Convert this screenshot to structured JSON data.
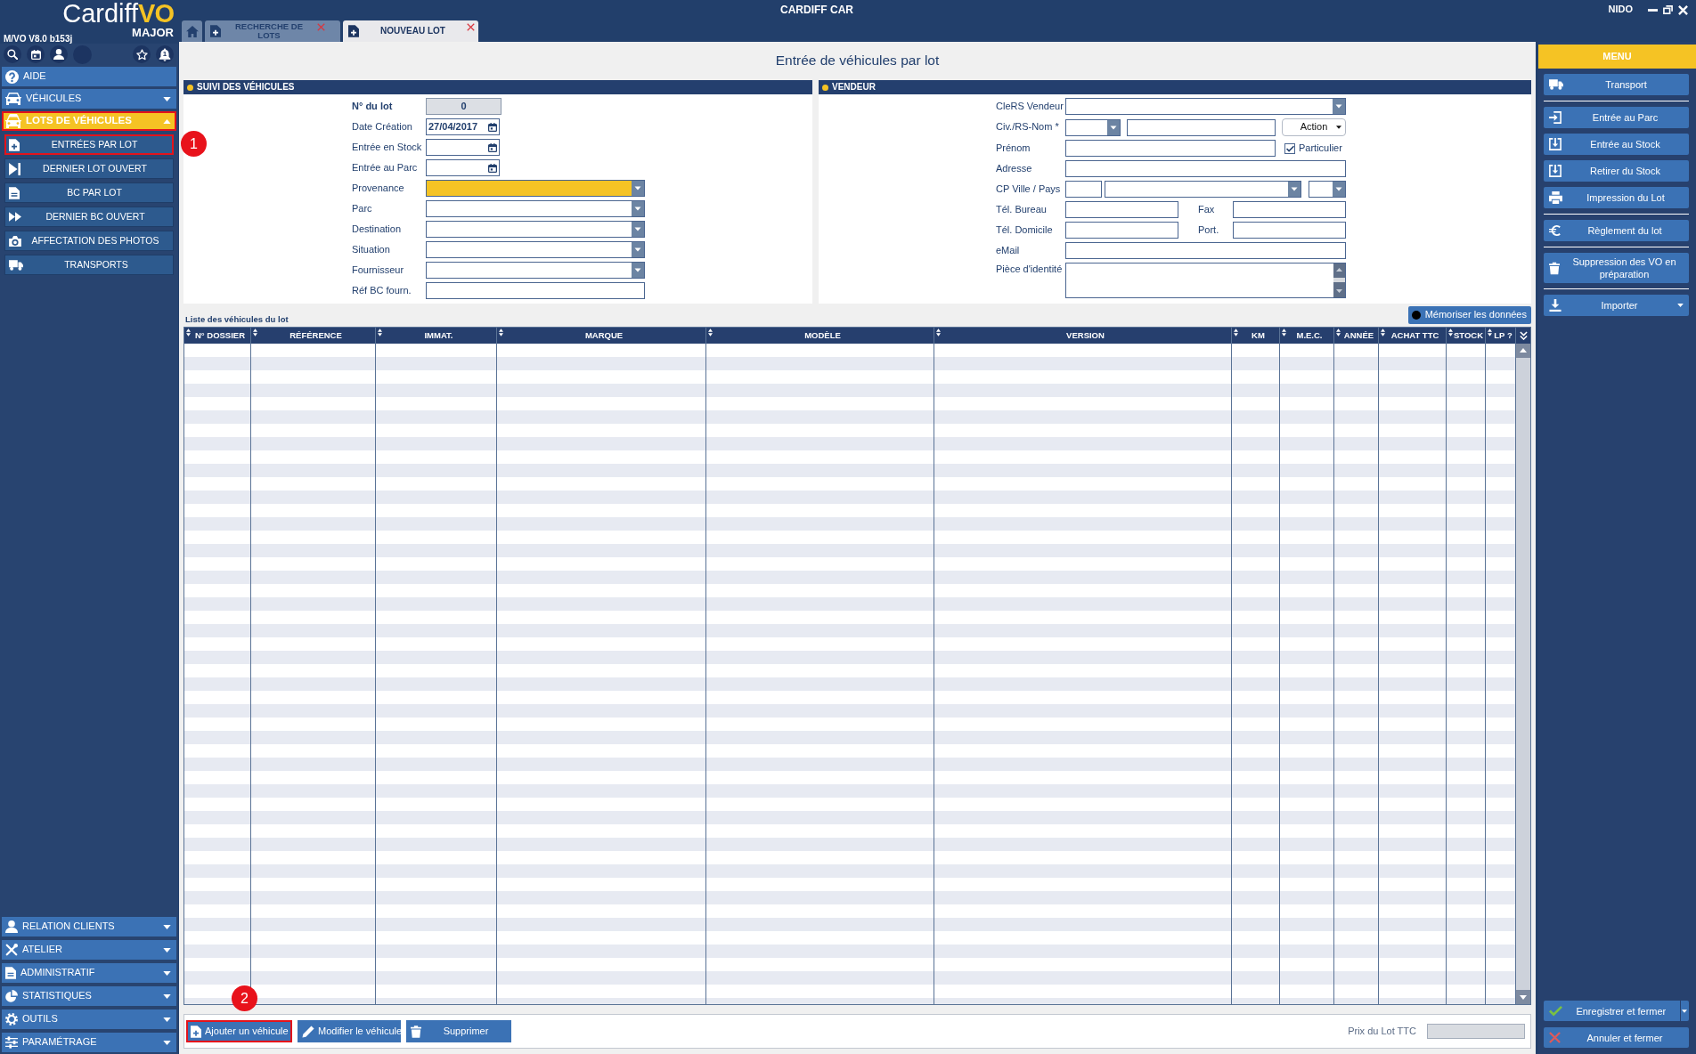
{
  "window": {
    "title": "CARDIFF CAR",
    "user": "NIDO"
  },
  "sidebar": {
    "logo": {
      "name": "Cardiff",
      "mark": "VO",
      "edition": "MAJOR"
    },
    "version": "M/VO V8.0 b153j",
    "notification_count": "1",
    "help": {
      "label": "AIDE"
    },
    "top_sections": [
      {
        "label": "VÉHICULES",
        "expanded": false,
        "selected": false,
        "highlighted": false
      },
      {
        "label": "LOTS DE VÉHICULES",
        "expanded": true,
        "selected": true,
        "highlighted": true,
        "children": [
          {
            "label": "ENTRÉES PAR LOT",
            "selected": false,
            "highlighted": true,
            "annotation": "1"
          },
          {
            "label": "DERNIER LOT OUVERT",
            "selected": false,
            "highlighted": false
          },
          {
            "label": "BC PAR LOT",
            "selected": false,
            "highlighted": false
          },
          {
            "label": "DERNIER BC OUVERT",
            "selected": false,
            "highlighted": false
          },
          {
            "label": "AFFECTATION DES PHOTOS",
            "selected": false,
            "highlighted": false
          },
          {
            "label": "TRANSPORTS",
            "selected": false,
            "highlighted": false
          }
        ]
      }
    ],
    "bottom_sections": [
      {
        "label": "RELATION CLIENTS",
        "expanded": false,
        "selected": false,
        "highlighted": false
      },
      {
        "label": "ATELIER",
        "expanded": false,
        "selected": false,
        "highlighted": false
      },
      {
        "label": "ADMINISTRATIF",
        "expanded": false,
        "selected": false,
        "highlighted": false
      },
      {
        "label": "STATISTIQUES",
        "expanded": false,
        "selected": false,
        "highlighted": false
      },
      {
        "label": "OUTILS",
        "expanded": false,
        "selected": false,
        "highlighted": false
      },
      {
        "label": "PARAMÉTRAGE",
        "expanded": false,
        "selected": false,
        "highlighted": false
      }
    ]
  },
  "tabs": [
    {
      "kind": "home",
      "selected": false
    },
    {
      "kind": "page",
      "label": "RECHERCHE DE LOTS",
      "selected": false
    },
    {
      "kind": "page",
      "label": "NOUVEAU LOT",
      "selected": true
    }
  ],
  "page_title": "Entrée de véhicules par lot",
  "lot_panel": {
    "title": "SUIVI DES VÉHICULES",
    "fields": [
      {
        "label": "N° du lot",
        "kind": "readonly",
        "value": "0",
        "focused": false
      },
      {
        "label": "Date Création",
        "kind": "date",
        "value": "27/04/2017",
        "focused": false
      },
      {
        "label": "Entrée en Stock",
        "kind": "date",
        "focused": false
      },
      {
        "label": "Entrée au Parc",
        "kind": "date",
        "focused": false
      },
      {
        "label": "Provenance",
        "kind": "select",
        "focused": true
      },
      {
        "label": "Parc",
        "kind": "select",
        "focused": false
      },
      {
        "label": "Destination",
        "kind": "select",
        "focused": false
      },
      {
        "label": "Situation",
        "kind": "select",
        "focused": false
      },
      {
        "label": "Fournisseur",
        "kind": "select",
        "focused": false
      },
      {
        "label": "Réf BC fourn.",
        "kind": "text",
        "focused": false
      }
    ]
  },
  "seller_panel": {
    "title": "VENDEUR",
    "rows": [
      {
        "kind": "select",
        "label": "CleRS Vendeur"
      },
      {
        "kind": "civility",
        "label": "Civ./RS-Nom *",
        "action": "Action"
      },
      {
        "kind": "name",
        "label": "Prénom",
        "checkbox": {
          "label": "Particulier",
          "checked": true
        }
      },
      {
        "kind": "text",
        "label": "Adresse"
      },
      {
        "kind": "city",
        "label": "CP Ville / Pays"
      },
      {
        "kind": "pair",
        "label": "Tél. Bureau",
        "second_label": "Fax"
      },
      {
        "kind": "pair",
        "label": "Tél. Domicile",
        "second_label": "Port."
      },
      {
        "kind": "text",
        "label": "eMail"
      },
      {
        "kind": "textarea",
        "label": "Pièce d'identité"
      }
    ]
  },
  "vehicle_list": {
    "caption": "Liste des véhicules du lot",
    "memorize_button": "Mémoriser les données",
    "columns": [
      "N° DOSSIER",
      "RÉFÉRENCE",
      "IMMAT.",
      "MARQUE",
      "MODÈLE",
      "VERSION",
      "KM",
      "M.E.C.",
      "ANNÉE",
      "ACHAT TTC",
      "STOCK",
      "LP ?"
    ]
  },
  "toolbar": {
    "buttons": [
      {
        "label": "Ajouter un véhicule",
        "highlighted": true,
        "annotation": "2"
      },
      {
        "label": "Modifier le véhicule",
        "highlighted": false
      },
      {
        "label": "Supprimer",
        "highlighted": false
      }
    ],
    "total_label": "Prix du Lot TTC"
  },
  "menu": {
    "title": "MENU",
    "groups": [
      {
        "items": [
          {
            "label": "Transport",
            "kind": "button"
          }
        ]
      },
      {
        "items": [
          {
            "label": "Entrée au Parc",
            "kind": "button"
          },
          {
            "label": "Entrée au Stock",
            "kind": "button"
          },
          {
            "label": "Retirer du Stock",
            "kind": "button"
          },
          {
            "label": "Impression du Lot",
            "kind": "button"
          }
        ]
      },
      {
        "items": [
          {
            "label": "Règlement du lot",
            "kind": "button"
          }
        ]
      },
      {
        "items": [
          {
            "label": "Suppression des VO en préparation",
            "kind": "button"
          }
        ]
      },
      {
        "items": [
          {
            "label": "Importer",
            "kind": "dropdown"
          }
        ]
      }
    ],
    "footer": [
      {
        "label": "Enregistrer et fermer",
        "kind": "split"
      },
      {
        "label": "Annuler et fermer",
        "kind": "button"
      }
    ]
  }
}
